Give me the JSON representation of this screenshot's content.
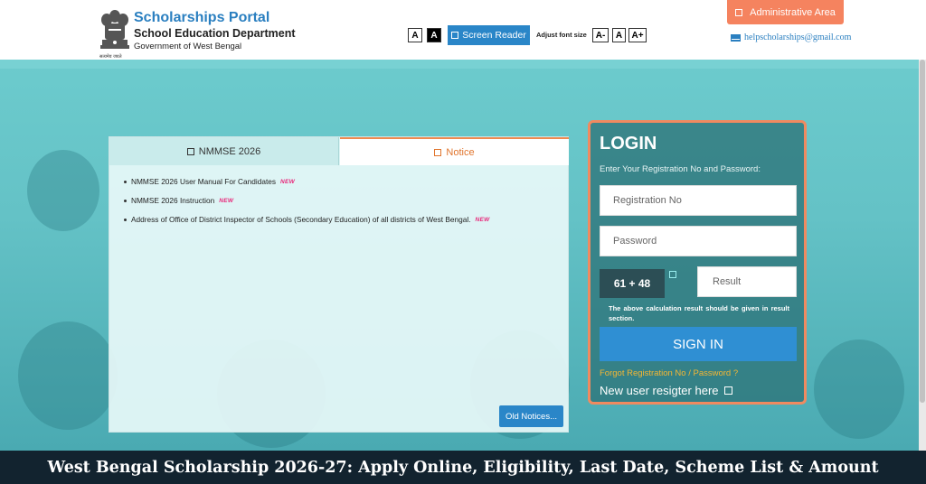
{
  "header": {
    "emblem_caption": "सत्यमेव जयते",
    "portal_title": "Scholarships Portal",
    "department": "School Education Department",
    "government": "Government of West Bengal",
    "contrast_light": "A",
    "contrast_dark": "A",
    "screen_reader_label": "Screen Reader",
    "adjust_font_label": "Adjust font size",
    "font_decrease": "A-",
    "font_normal": "A",
    "font_increase": "A+",
    "admin_label": "Administrative Area",
    "email": "helpscholarships@gmail.com"
  },
  "tabs": [
    {
      "label": "NMMSE 2026"
    },
    {
      "label": "Notice"
    }
  ],
  "notices": [
    {
      "text": "NMMSE 2026 User Manual For Candidates",
      "badge": "NEW"
    },
    {
      "text": "NMMSE 2026 Instruction",
      "badge": "NEW"
    },
    {
      "text": "Address of Office of District Inspector of Schools (Secondary Education) of all districts of West Bengal.",
      "badge": "NEW"
    }
  ],
  "old_notices_label": "Old Notices...",
  "login": {
    "title": "LOGIN",
    "subtitle": "Enter Your Registration No and Password:",
    "registration_placeholder": "Registration No",
    "password_placeholder": "Password",
    "captcha": "61 + 48",
    "result_placeholder": "Result",
    "captcha_note": "The above calculation result should be given in result section.",
    "signin_label": "SIGN IN",
    "forgot_label": "Forgot Registration No / Password ?",
    "new_user_label": "New user resigter here"
  },
  "banner": "West Bengal Scholarship 2026-27: Apply Online, Eligibility, Last Date, Scheme List & Amount",
  "colors": {
    "accent_blue": "#2a86c8",
    "admin_orange": "#f5835f",
    "notice_orange": "#e0742c",
    "new_badge": "#e8287a",
    "banner_bg": "#12232f"
  }
}
